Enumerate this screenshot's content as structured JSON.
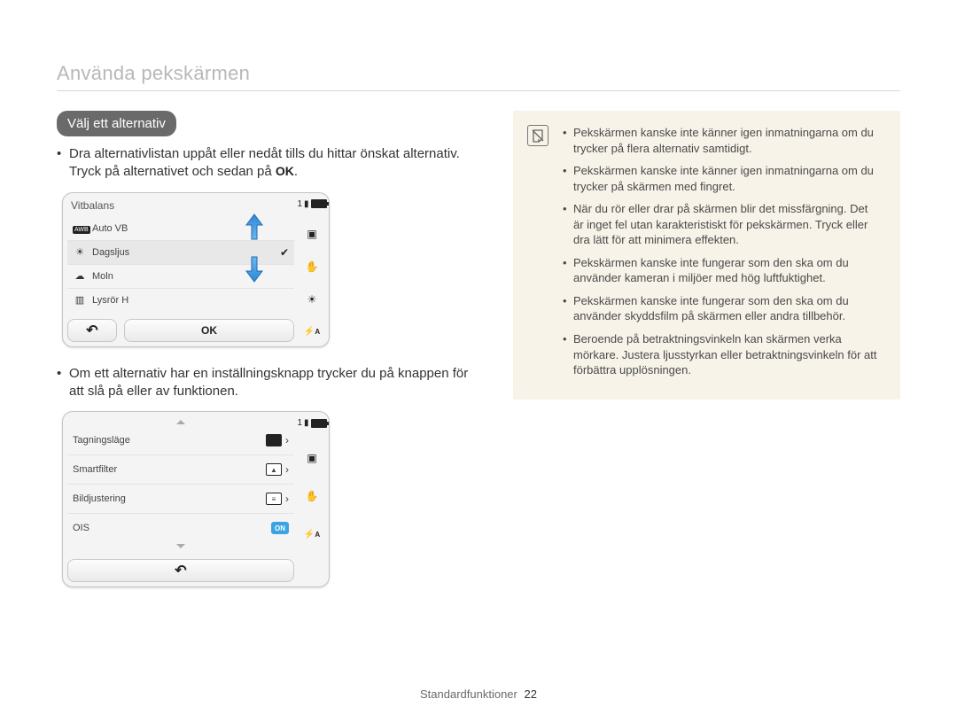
{
  "header": "Använda pekskärmen",
  "section_title": "Välj ett alternativ",
  "para1_a": "Dra alternativlistan uppåt eller nedåt tills du hittar önskat alternativ. Tryck på alternativet och sedan på ",
  "para1_ok": "OK",
  "para1_b": ".",
  "device1": {
    "title": "Vitbalans",
    "count": "1",
    "rows": {
      "r0": {
        "label": "Auto VB"
      },
      "r1": {
        "label": "Dagsljus",
        "selected": true
      },
      "r2": {
        "label": "Moln"
      },
      "r3": {
        "label": "Lysrör H"
      }
    },
    "ok_label": "OK",
    "side": {
      "flash_label": "A"
    }
  },
  "para2": "Om ett alternativ har en inställningsknapp trycker du på knappen för att slå på eller av funktionen.",
  "device2": {
    "count": "1",
    "rows": {
      "r0": {
        "label": "Tagningsläge"
      },
      "r1": {
        "label": "Smartfilter"
      },
      "r2": {
        "label": "Bildjustering"
      },
      "r3": {
        "label": "OIS",
        "on": "ON"
      }
    },
    "side": {
      "flash_label": "A"
    }
  },
  "notes": {
    "n0": "Pekskärmen kanske inte känner igen inmatningarna om du trycker på flera alternativ samtidigt.",
    "n1": "Pekskärmen kanske inte känner igen inmatningarna om du trycker på skärmen med fingret.",
    "n2": "När du rör eller drar på skärmen blir det missfärgning. Det är inget fel utan karakteristiskt för pekskärmen. Tryck eller dra lätt för att minimera effekten.",
    "n3": "Pekskärmen kanske inte fungerar som den ska om du använder kameran i miljöer med hög luftfuktighet.",
    "n4": "Pekskärmen kanske inte fungerar som den ska om du använder skyddsfilm på skärmen eller andra tillbehör.",
    "n5": "Beroende på betraktningsvinkeln kan skärmen verka mörkare. Justera ljusstyrkan eller betraktningsvinkeln för att förbättra upplösningen."
  },
  "footer": {
    "section": "Standardfunktioner",
    "page": "22"
  }
}
